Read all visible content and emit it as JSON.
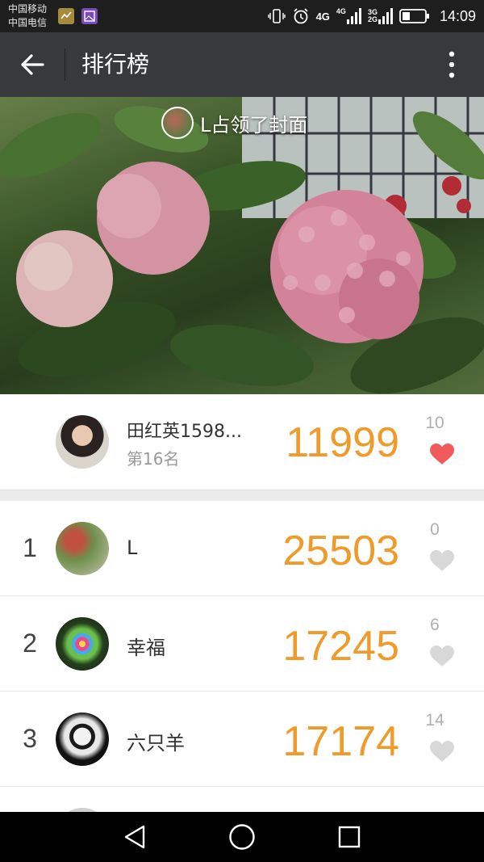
{
  "status_bar": {
    "carrier_1": "中国移动",
    "carrier_2": "中国电信",
    "network_1": "4G",
    "network_2_top": "4G",
    "network_3_top": "3G",
    "network_3_bottom": "2G",
    "time": "14:09"
  },
  "app_bar": {
    "title": "排行榜",
    "back_icon": "arrow-left-icon",
    "menu_icon": "more-vertical-icon"
  },
  "cover": {
    "owner_text": "L占领了封面"
  },
  "my_rank": {
    "name": "田红英1598...",
    "rank_text": "第16名",
    "score": "11999",
    "likes": "10",
    "liked": true
  },
  "rankings": [
    {
      "rank": "1",
      "name": "L",
      "score": "25503",
      "likes": "0",
      "liked": false
    },
    {
      "rank": "2",
      "name": "幸福",
      "score": "17245",
      "likes": "6",
      "liked": false
    },
    {
      "rank": "3",
      "name": "六只羊",
      "score": "17174",
      "likes": "14",
      "liked": false
    }
  ],
  "colors": {
    "score": "#f09a2a",
    "heart_active": "#f05a5a",
    "heart_inactive": "#d8d8d8",
    "app_bar": "#38393d"
  }
}
